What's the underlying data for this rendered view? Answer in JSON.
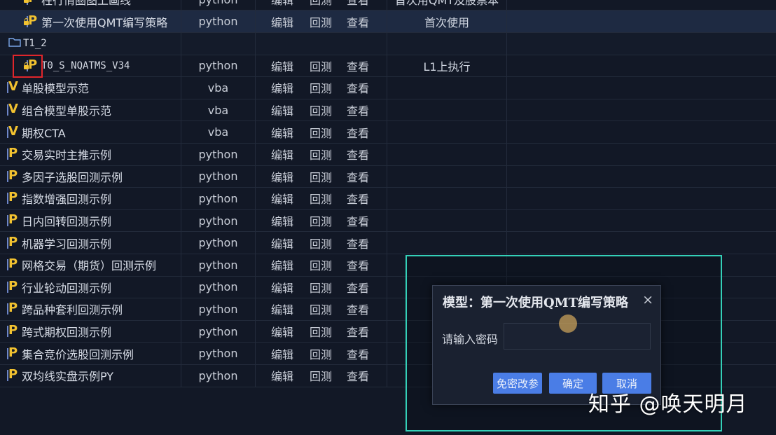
{
  "table": {
    "rows": [
      {
        "type": "file",
        "icon": "python-locked-file-icon",
        "name": "柱行情圈图上画线",
        "lang": "python",
        "edit": "编辑",
        "backtest": "回测",
        "view": "查看",
        "note": "首次用QMT及股票本"
      },
      {
        "type": "file",
        "icon": "python-locked-file-icon",
        "name": "第一次使用QMT编写策略",
        "lang": "python",
        "edit": "编辑",
        "backtest": "回测",
        "view": "查看",
        "note": "首次使用",
        "selected": true
      },
      {
        "type": "folder",
        "icon": "folder-icon",
        "name": "T1_2"
      },
      {
        "type": "file",
        "icon": "python-locked-file-icon",
        "name": "T0_S_NQATMS_V34",
        "lang": "python",
        "edit": "编辑",
        "backtest": "回测",
        "view": "查看",
        "note": "L1上执行"
      },
      {
        "type": "file",
        "icon": "vba-file-icon",
        "name": "单股模型示范",
        "lang": "vba",
        "edit": "编辑",
        "backtest": "回测",
        "view": "查看",
        "note": ""
      },
      {
        "type": "file",
        "icon": "vba-file-icon",
        "name": "组合模型单股示范",
        "lang": "vba",
        "edit": "编辑",
        "backtest": "回测",
        "view": "查看",
        "note": ""
      },
      {
        "type": "file",
        "icon": "vba-file-icon",
        "name": "期权CTA",
        "lang": "vba",
        "edit": "编辑",
        "backtest": "回测",
        "view": "查看",
        "note": ""
      },
      {
        "type": "file",
        "icon": "python-file-icon",
        "name": "交易实时主推示例",
        "lang": "python",
        "edit": "编辑",
        "backtest": "回测",
        "view": "查看",
        "note": ""
      },
      {
        "type": "file",
        "icon": "python-file-icon",
        "name": "多因子选股回测示例",
        "lang": "python",
        "edit": "编辑",
        "backtest": "回测",
        "view": "查看",
        "note": ""
      },
      {
        "type": "file",
        "icon": "python-file-icon",
        "name": "指数增强回测示例",
        "lang": "python",
        "edit": "编辑",
        "backtest": "回测",
        "view": "查看",
        "note": ""
      },
      {
        "type": "file",
        "icon": "python-file-icon",
        "name": "日内回转回测示例",
        "lang": "python",
        "edit": "编辑",
        "backtest": "回测",
        "view": "查看",
        "note": ""
      },
      {
        "type": "file",
        "icon": "python-file-icon",
        "name": "机器学习回测示例",
        "lang": "python",
        "edit": "编辑",
        "backtest": "回测",
        "view": "查看",
        "note": ""
      },
      {
        "type": "file",
        "icon": "python-file-icon",
        "name": "网格交易（期货）回测示例",
        "lang": "python",
        "edit": "编辑",
        "backtest": "回测",
        "view": "查看",
        "note": ""
      },
      {
        "type": "file",
        "icon": "python-file-icon",
        "name": "行业轮动回测示例",
        "lang": "python",
        "edit": "编辑",
        "backtest": "回测",
        "view": "查看",
        "note": ""
      },
      {
        "type": "file",
        "icon": "python-file-icon",
        "name": "跨品种套利回测示例",
        "lang": "python",
        "edit": "编辑",
        "backtest": "回测",
        "view": "查看",
        "note": ""
      },
      {
        "type": "file",
        "icon": "python-file-icon",
        "name": "跨式期权回测示例",
        "lang": "python",
        "edit": "编辑",
        "backtest": "回测",
        "view": "查看",
        "note": ""
      },
      {
        "type": "file",
        "icon": "python-file-icon",
        "name": "集合竞价选股回测示例",
        "lang": "python",
        "edit": "编辑",
        "backtest": "回测",
        "view": "查看",
        "note": ""
      },
      {
        "type": "file",
        "icon": "python-file-icon",
        "name": "双均线实盘示例PY",
        "lang": "python",
        "edit": "编辑",
        "backtest": "回测",
        "view": "查看",
        "note": ""
      }
    ]
  },
  "dialog": {
    "title": "模型：第一次使用QMT编写策略",
    "close": "×",
    "password_label": "请输入密码",
    "password_value": "",
    "btn_free": "免密改参",
    "btn_ok": "确定",
    "btn_cancel": "取消"
  },
  "watermark": "知乎 @唤天明月",
  "colors": {
    "background": "#121826",
    "selected_row": "#1e2a42",
    "icon_yellow": "#f2c230",
    "button_blue": "#4a7de6",
    "highlight_red": "#e0262b",
    "overlay_cyan": "#34d0b8"
  }
}
